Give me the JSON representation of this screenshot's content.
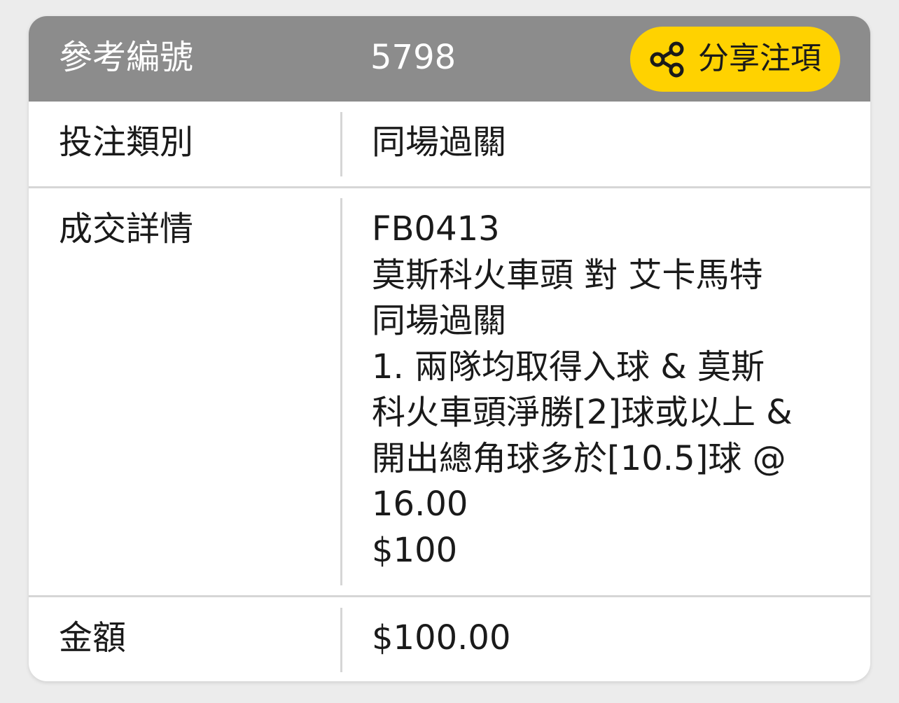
{
  "header": {
    "label": "參考編號",
    "reference": "5798",
    "share_label": "分享注項",
    "share_icon": "share-icon"
  },
  "rows": {
    "bet_type": {
      "label": "投注類別",
      "value": "同場過關"
    },
    "details": {
      "label": "成交詳情",
      "lines": [
        "FB0413",
        "莫斯科火車頭 對 艾卡馬特",
        "同場過關",
        "1. 兩隊均取得入球 & 莫斯",
        "科火車頭淨勝[2]球或以上 &",
        "開出總角球多於[10.5]球 @",
        "16.00",
        "$100"
      ]
    },
    "amount": {
      "label": "金額",
      "value": "$100.00"
    }
  },
  "colors": {
    "header_bg": "#8c8c8c",
    "accent": "#ffd200",
    "divider": "#d6d6d6",
    "text": "#1a1a1a"
  }
}
